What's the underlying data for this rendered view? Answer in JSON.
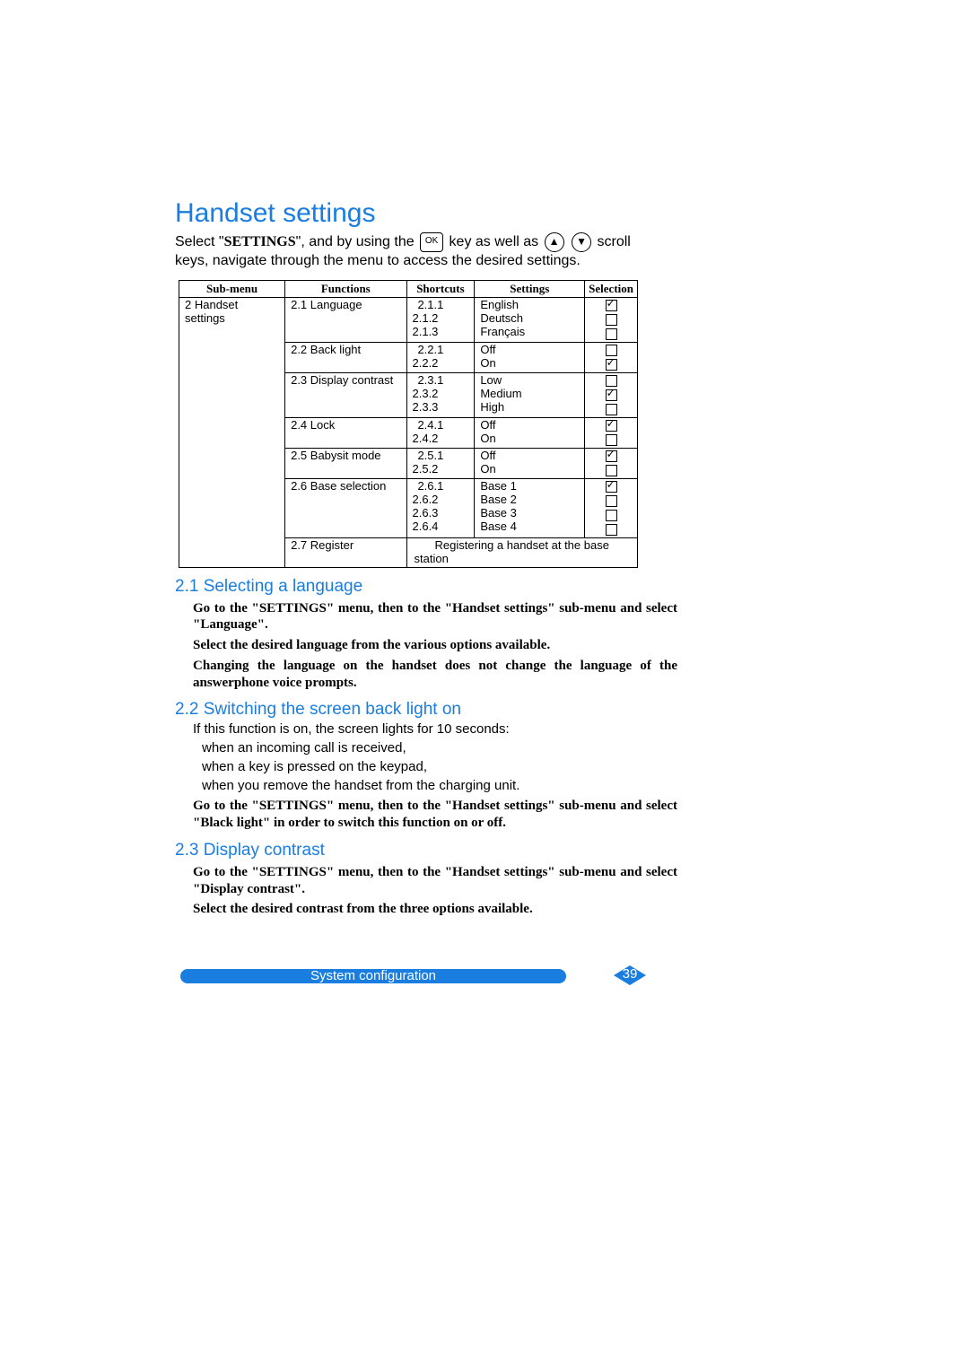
{
  "title": "Handset settings",
  "intro_prefix": "Select \"",
  "intro_settings": "SETTINGS",
  "intro_mid1": "\", and by using the",
  "intro_ok": "OK",
  "intro_mid2": " key as well as ",
  "intro_mid3": " scroll",
  "intro_line2": "keys, navigate through the menu to access the desired settings.",
  "table": {
    "headers": [
      "Sub-menu",
      "Functions",
      "Shortcuts",
      "Settings",
      "Selection"
    ],
    "submenu": "2 Handset settings",
    "rows": [
      {
        "fn": "2.1 Language",
        "sc": [
          "2.1.1",
          "2.1.2",
          "2.1.3"
        ],
        "set": [
          "English",
          "Deutsch",
          "Français"
        ],
        "sel": [
          true,
          false,
          false
        ],
        "first_sc_center": true
      },
      {
        "fn": "2.2 Back light",
        "sc": [
          "2.2.1",
          "2.2.2"
        ],
        "set": [
          "Off",
          "On"
        ],
        "sel": [
          false,
          true
        ],
        "first_sc_center": true
      },
      {
        "fn": "2.3 Display contrast",
        "sc": [
          "2.3.1",
          "2.3.2",
          "2.3.3"
        ],
        "set": [
          "Low",
          "Medium",
          "High"
        ],
        "sel": [
          false,
          true,
          false
        ],
        "first_sc_center": true
      },
      {
        "fn": "2.4 Lock",
        "sc": [
          "2.4.1",
          "2.4.2"
        ],
        "set": [
          "Off",
          "On"
        ],
        "sel": [
          true,
          false
        ],
        "first_sc_center": true
      },
      {
        "fn": "2.5 Babysit mode",
        "sc": [
          "2.5.1",
          "2.5.2"
        ],
        "set": [
          "Off",
          "On"
        ],
        "sel": [
          true,
          false
        ],
        "first_sc_center": true
      },
      {
        "fn": "2.6 Base selection",
        "sc": [
          "2.6.1",
          "2.6.2",
          "2.6.3",
          "2.6.4"
        ],
        "set": [
          "Base 1",
          "Base 2",
          "Base 3",
          "Base 4"
        ],
        "sel": [
          true,
          false,
          false,
          false
        ],
        "first_sc_center": true
      }
    ],
    "register_fn": "2.7 Register",
    "register_text": "Registering a handset at the base station"
  },
  "s21": {
    "heading": "2.1 Selecting a language",
    "p1": "Go to the \"SETTINGS\" menu, then to the \"Handset settings\" sub-menu and select \"Language\".",
    "p2": "Select the desired language from the various options available.",
    "p3": "Changing the language on the handset does not change the language of the answerphone voice prompts."
  },
  "s22": {
    "heading": "2.2 Switching the screen back light on",
    "p1": "If this function is on, the screen lights for 10 seconds:",
    "b1": "when an incoming call is received,",
    "b2": "when a key is pressed on the keypad,",
    "b3": "when you remove the handset from the charging unit.",
    "p2": "Go to the \"SETTINGS\" menu, then to the \"Handset settings\" sub-menu and select \"Black light\" in order to switch this function on or off."
  },
  "s23": {
    "heading": "2.3 Display contrast",
    "p1": "Go to the \"SETTINGS\" menu, then to the \"Handset settings\" sub-menu and select \"Display contrast\".",
    "p2": "Select the desired contrast from the three options available."
  },
  "footer": {
    "label": "System configuration",
    "page": "39"
  }
}
